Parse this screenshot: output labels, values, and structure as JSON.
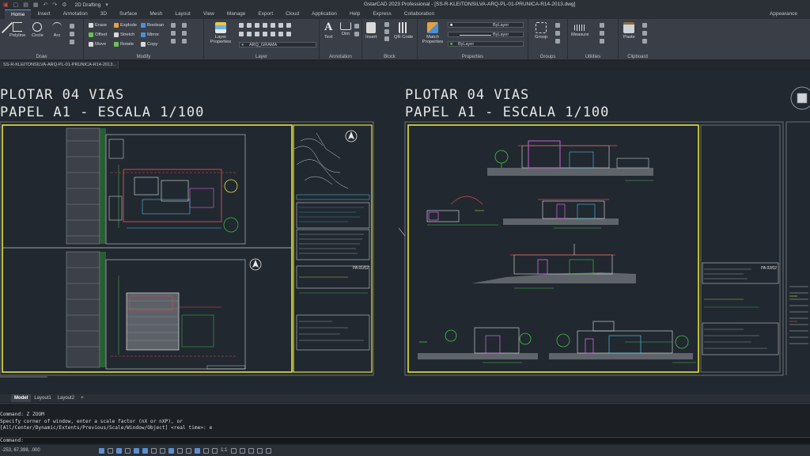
{
  "titlebar": {
    "workspace": "2D Drafting",
    "title": "GstarCAD 2023 Professional - [SS-R-KLEITONSILVA-ARQ-PL-01-PRUNICA-R14-2013.dwg]"
  },
  "tabs": [
    "Home",
    "Insert",
    "Annotation",
    "3D",
    "Surface",
    "Mesh",
    "Layout",
    "View",
    "Manage",
    "Export",
    "Cloud",
    "Application",
    "Help",
    "Express",
    "Collaboration"
  ],
  "appearance": "Appearance",
  "ribbon": {
    "draw": {
      "title": "Draw",
      "tools": [
        "Line",
        "Polyline",
        "Circle",
        "Arc"
      ]
    },
    "modify": {
      "title": "Modify",
      "tools": [
        "Erase",
        "Explode",
        "Boolean",
        "Offset",
        "Stretch",
        "Mirror",
        "Move",
        "Rotate",
        "Copy"
      ]
    },
    "layer": {
      "title": "Layer",
      "big": "Layer Properties",
      "current": "ARQ_GRAMA"
    },
    "annotation": {
      "title": "Annotation",
      "tools": [
        "Text",
        "Dim"
      ]
    },
    "block": {
      "title": "Block",
      "tools": [
        "Insert",
        "QR Code"
      ]
    },
    "properties": {
      "title": "Properties",
      "big": "Match Properties",
      "bylayer1": "ByLayer",
      "bylayer2": "ByLayer",
      "bylayer3": "ByLayer"
    },
    "groups": {
      "title": "Groups",
      "big": "Group"
    },
    "utilities": {
      "title": "Utilities",
      "big": "Measure"
    },
    "clipboard": {
      "title": "Clipboard",
      "big": "Paste"
    }
  },
  "file_tab": "SS-R-KLEITONSILVA-ARQ-PL-01-PRUNICA-R14-2013...",
  "sheets": [
    {
      "line1": "PLOTAR 04 VIAS",
      "line2": "PAPEL A1 - ESCALA 1/100",
      "sheet_no": "PA 01/02"
    },
    {
      "line1": "PLOTAR 04 VIAS",
      "line2": "PAPEL A1 - ESCALA 1/100",
      "sheet_no": "PA 02/02"
    }
  ],
  "layout_tabs": [
    "Model",
    "Layout1",
    "Layout2",
    "+"
  ],
  "command": {
    "lines": [
      "Command: Z ZOOM",
      "Specify corner of window, enter a scale factor (nX or nXP), or",
      "[All/Center/Dynamic/Extents/Previous/Scale/Window/Object] <real time>: e"
    ],
    "prompt": "Command:"
  },
  "status": {
    "coords": "-253, 67.398, .000",
    "scale": "1:1"
  },
  "colors": {
    "sheet_border": "#e5e33a",
    "ribbon_bg": "#3a3f47",
    "canvas_bg": "#212830"
  }
}
